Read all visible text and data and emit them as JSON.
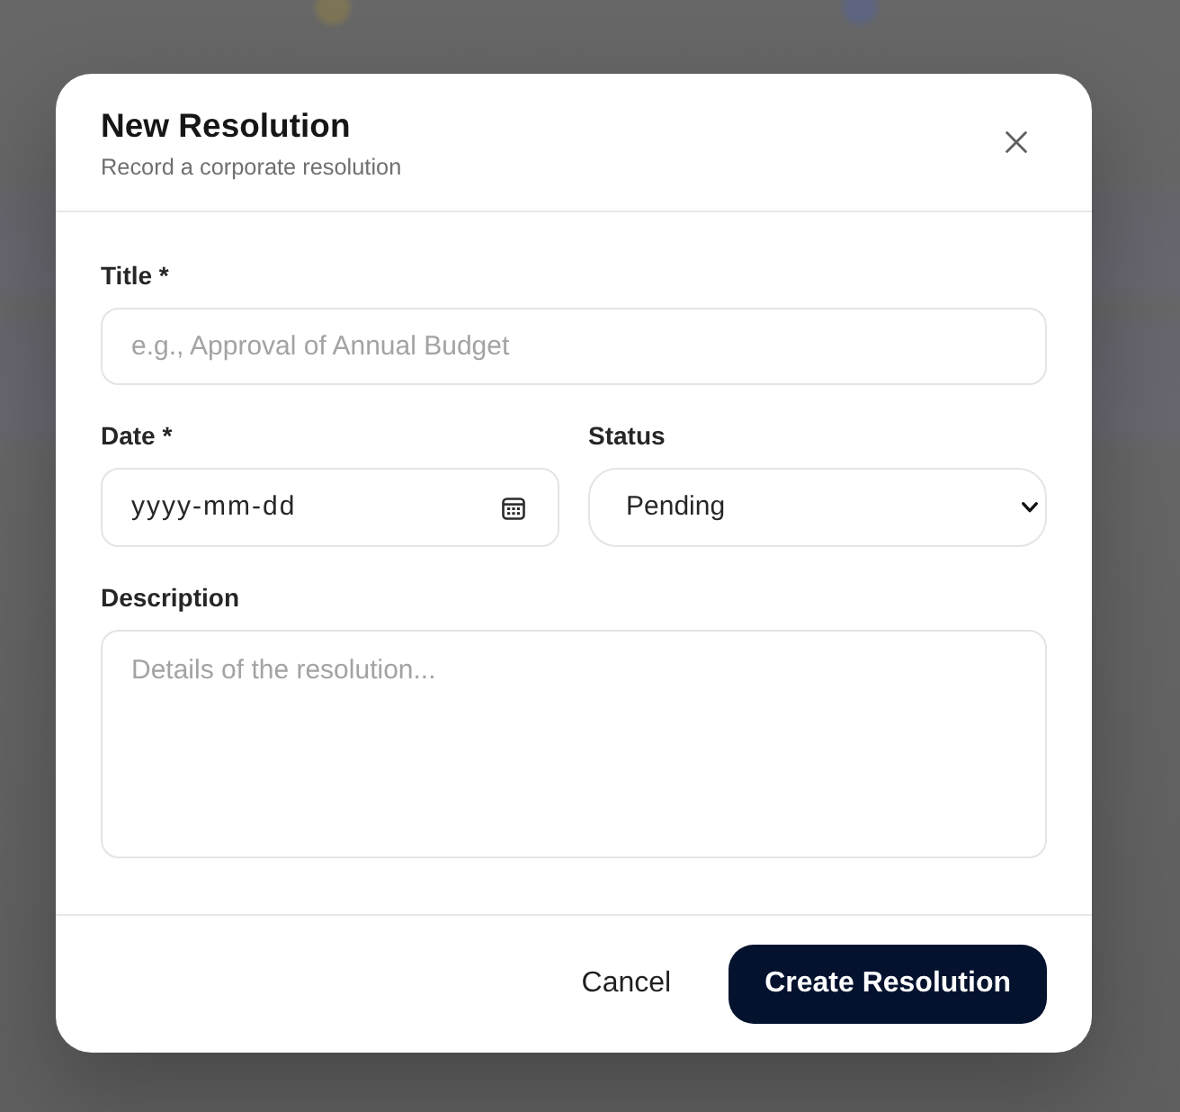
{
  "dialog": {
    "title": "New Resolution",
    "subtitle": "Record a corporate resolution"
  },
  "fields": [
    {
      "kind": "text",
      "label": "Title *",
      "placeholder": "e.g., Approval of Annual Budget"
    },
    {
      "kind": "date",
      "label": "Date *",
      "placeholder": "yyyy-mm-dd"
    },
    {
      "kind": "select",
      "label": "Status",
      "value": "Pending"
    },
    {
      "kind": "textarea",
      "label": "Description",
      "placeholder": "Details of the resolution..."
    }
  ],
  "buttons": [
    {
      "kind": "secondary",
      "label": "Cancel"
    },
    {
      "kind": "primary",
      "label": "Create Resolution"
    }
  ]
}
